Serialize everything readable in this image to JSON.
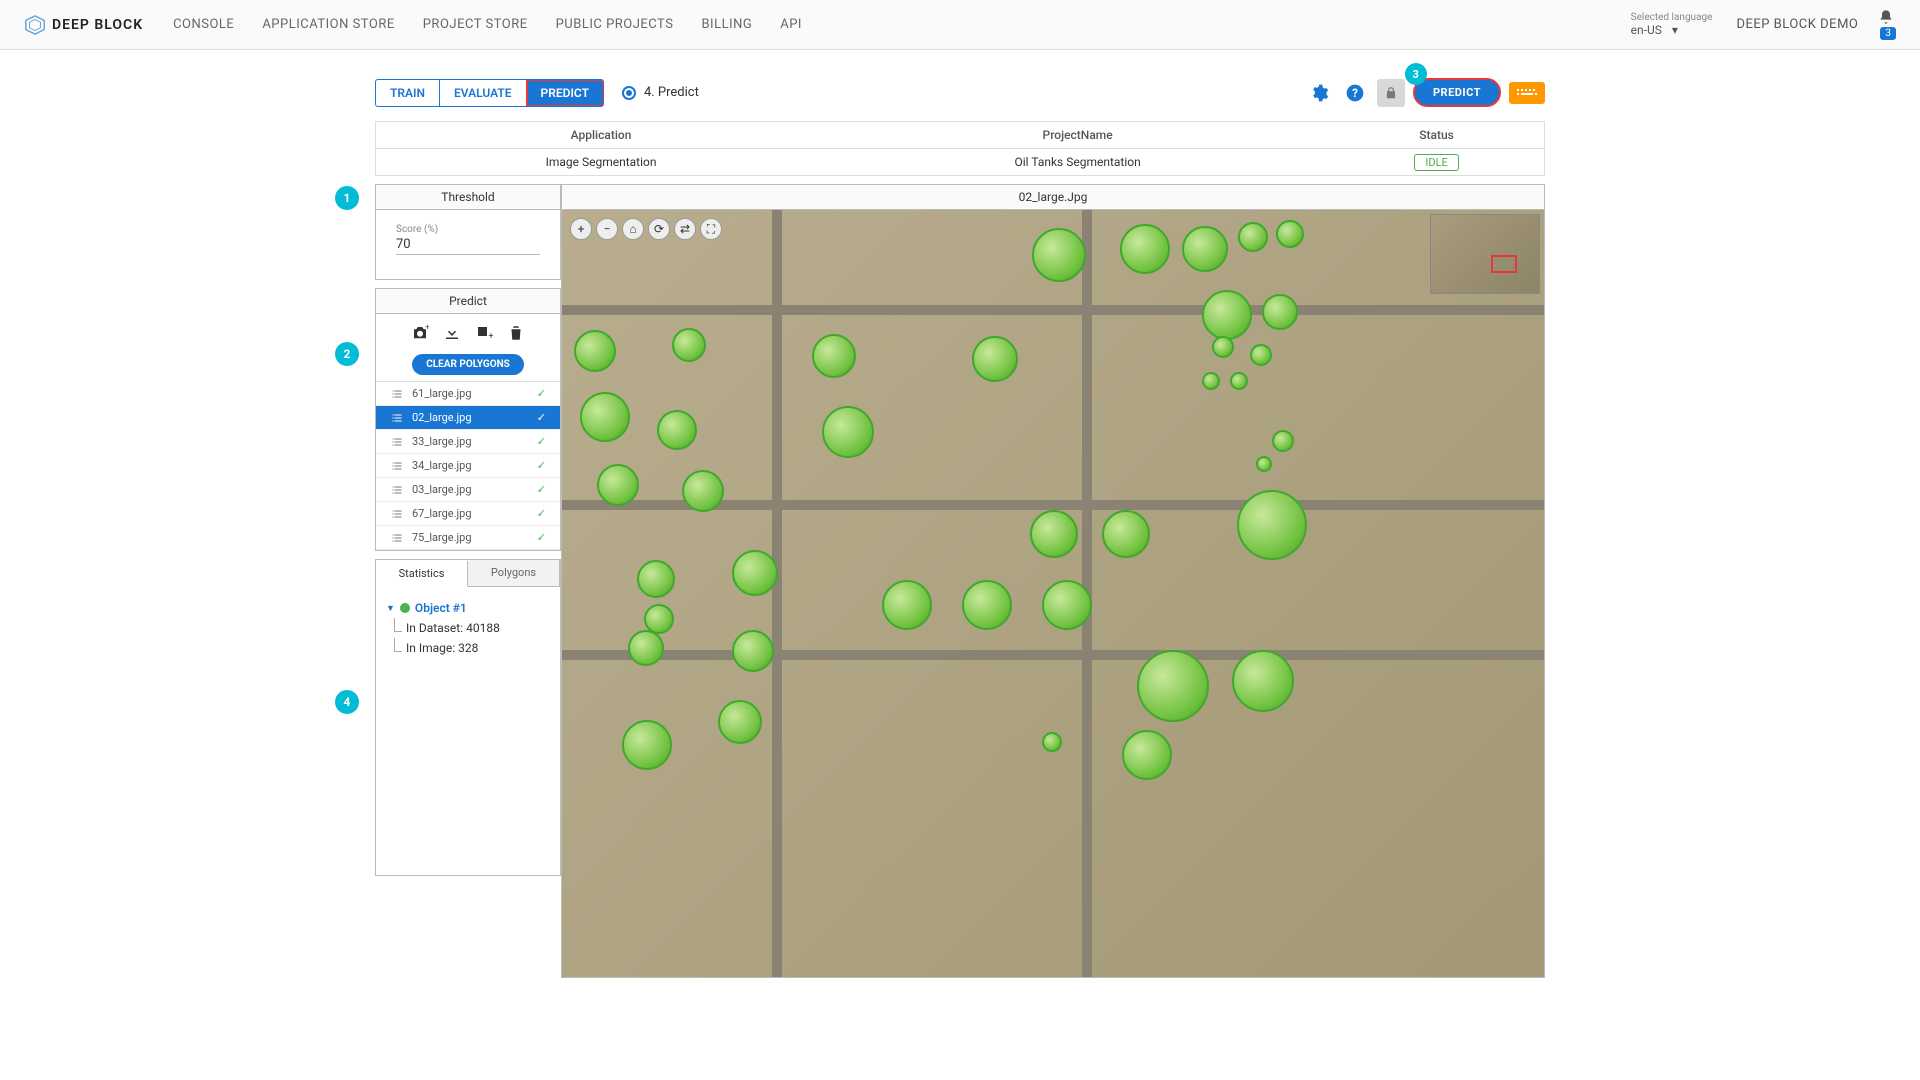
{
  "brand": "DEEP BLOCK",
  "nav": [
    "CONSOLE",
    "APPLICATION STORE",
    "PROJECT STORE",
    "PUBLIC PROJECTS",
    "BILLING",
    "API"
  ],
  "lang_label": "Selected language",
  "lang_value": "en-US",
  "user": "DEEP BLOCK DEMO",
  "notif_count": "3",
  "mode_tabs": {
    "train": "TRAIN",
    "evaluate": "EVALUATE",
    "predict": "PREDICT"
  },
  "step_text": "4. Predict",
  "predict_btn": "PREDICT",
  "callouts": {
    "c1": "1",
    "c2": "2",
    "c3": "3",
    "c4": "4"
  },
  "info": {
    "headers": {
      "app": "Application",
      "project": "ProjectName",
      "status": "Status"
    },
    "app": "Image Segmentation",
    "project": "Oil Tanks Segmentation",
    "status": "IDLE"
  },
  "threshold": {
    "title": "Threshold",
    "score_label": "Score (%)",
    "score_value": "70"
  },
  "predict_panel": {
    "title": "Predict",
    "clear": "CLEAR POLYGONS"
  },
  "images": [
    {
      "name": "61_large.jpg",
      "done": true,
      "selected": false
    },
    {
      "name": "02_large.jpg",
      "done": true,
      "selected": true
    },
    {
      "name": "33_large.jpg",
      "done": true,
      "selected": false
    },
    {
      "name": "34_large.jpg",
      "done": true,
      "selected": false
    },
    {
      "name": "03_large.jpg",
      "done": true,
      "selected": false
    },
    {
      "name": "67_large.jpg",
      "done": true,
      "selected": false
    },
    {
      "name": "75_large.jpg",
      "done": true,
      "selected": false
    }
  ],
  "stats": {
    "tabs": {
      "statistics": "Statistics",
      "polygons": "Polygons"
    },
    "object_label": "Object #1",
    "in_dataset": "In Dataset: 40188",
    "in_image": "In Image: 328"
  },
  "viewer_title": "02_large.Jpg",
  "icons": {
    "settings": "gear-icon",
    "help": "help-icon",
    "lock": "lock-icon",
    "keyboard": "keyboard-icon",
    "bell": "bell-icon",
    "camera": "camera-icon",
    "download": "download-icon",
    "add_img": "add-image-icon",
    "trash": "trash-icon",
    "zoom_in": "+",
    "zoom_out": "−",
    "home": "⌂",
    "ref1": "⟳",
    "ref2": "⇄",
    "full": "⛶"
  }
}
